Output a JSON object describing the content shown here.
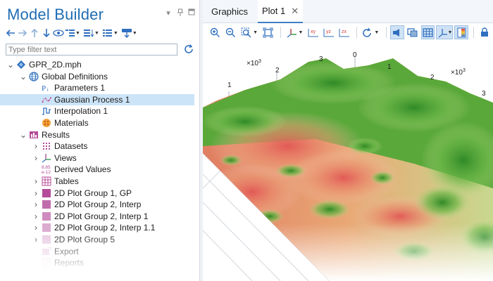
{
  "panel": {
    "title": "Model Builder",
    "filter_placeholder": "Type filter text"
  },
  "tree": [
    {
      "label": "GPR_2D.mph",
      "icon": "model-icon",
      "level": 0,
      "toggle": "v"
    },
    {
      "label": "Global Definitions",
      "icon": "globe-icon",
      "level": 1,
      "toggle": "v"
    },
    {
      "label": "Parameters 1",
      "icon": "parameters-icon",
      "level": 2,
      "toggle": ""
    },
    {
      "label": "Gaussian Process 1",
      "icon": "gaussian-process-icon",
      "level": 2,
      "toggle": "",
      "selected": true
    },
    {
      "label": "Interpolation 1",
      "icon": "interpolation-icon",
      "level": 2,
      "toggle": ""
    },
    {
      "label": "Materials",
      "icon": "materials-icon",
      "level": 2,
      "toggle": ""
    },
    {
      "label": "Results",
      "icon": "results-icon",
      "level": 1,
      "toggle": "v"
    },
    {
      "label": "Datasets",
      "icon": "datasets-icon",
      "level": 2,
      "toggle": ">"
    },
    {
      "label": "Views",
      "icon": "views-icon",
      "level": 2,
      "toggle": ">"
    },
    {
      "label": "Derived Values",
      "icon": "derived-values-icon",
      "level": 2,
      "toggle": ""
    },
    {
      "label": "Tables",
      "icon": "tables-icon",
      "level": 2,
      "toggle": ">"
    },
    {
      "label": "2D Plot Group 1, GP",
      "icon": "plot-group-icon",
      "level": 2,
      "toggle": ">"
    },
    {
      "label": "2D Plot Group 2, Interp",
      "icon": "plot-group-icon",
      "level": 2,
      "toggle": ">"
    },
    {
      "label": "2D Plot Group 2, Interp 1",
      "icon": "plot-group-icon",
      "level": 2,
      "toggle": ">"
    },
    {
      "label": "2D Plot Group 2, Interp 1.1",
      "icon": "plot-group-icon",
      "level": 2,
      "toggle": ">"
    },
    {
      "label": "2D Plot Group 5",
      "icon": "plot-group-icon",
      "level": 2,
      "toggle": ">"
    },
    {
      "label": "Export",
      "icon": "export-icon",
      "level": 2,
      "toggle": ""
    },
    {
      "label": "Reports",
      "icon": "reports-icon",
      "level": 2,
      "toggle": ""
    }
  ],
  "graphics": {
    "tabs": [
      {
        "label": "Graphics",
        "active": false
      },
      {
        "label": "Plot 1",
        "active": true
      }
    ],
    "axis_multiplier_left": "×10",
    "axis_multiplier_right": "×10",
    "axis_multiplier_exp": "3",
    "ticks_left": [
      "1",
      "2",
      "3"
    ],
    "ticks_right": [
      "0",
      "1",
      "2",
      "3"
    ]
  },
  "colors": {
    "accent": "#1f6db4",
    "selection": "#cce4f7",
    "surface_green": "#3e9b2f",
    "surface_red": "#e05a57"
  }
}
